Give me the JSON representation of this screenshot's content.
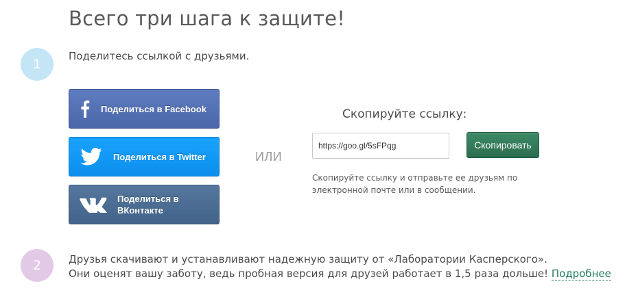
{
  "page": {
    "title": "Всего три шага к защите!"
  },
  "step1": {
    "number": "1",
    "text": "Поделитесь ссылкой с друзьями.",
    "share_buttons": [
      {
        "network": "facebook",
        "icon": "facebook-icon",
        "label": "Поделиться в Facebook",
        "color": "#5471b4"
      },
      {
        "network": "twitter",
        "icon": "twitter-icon",
        "label": "Поделиться в Twitter",
        "color": "#1597f5"
      },
      {
        "network": "vkontakte",
        "icon": "vk-icon",
        "label": "Поделиться в ВКонтакте",
        "color": "#4c6d93"
      }
    ],
    "or_label": "ИЛИ",
    "copy": {
      "heading": "Скопируйте ссылку:",
      "url": "https://goo.gl/5sFPqg",
      "button_label": "Скопировать",
      "button_color": "#347c5b",
      "hint": "Скопируйте ссылку и отправьте ее друзьям по электронной почте или в сообщении."
    }
  },
  "step2": {
    "number": "2",
    "line1": "Друзья скачивают и устанавливают надежную защиту от «Лаборатории Касперского».",
    "line2": "Они оценят вашу заботу, ведь пробная версия для друзей работает в 1,5 раза дольше!",
    "more_link": "Подробнее",
    "link_color": "#1f7a5a"
  }
}
